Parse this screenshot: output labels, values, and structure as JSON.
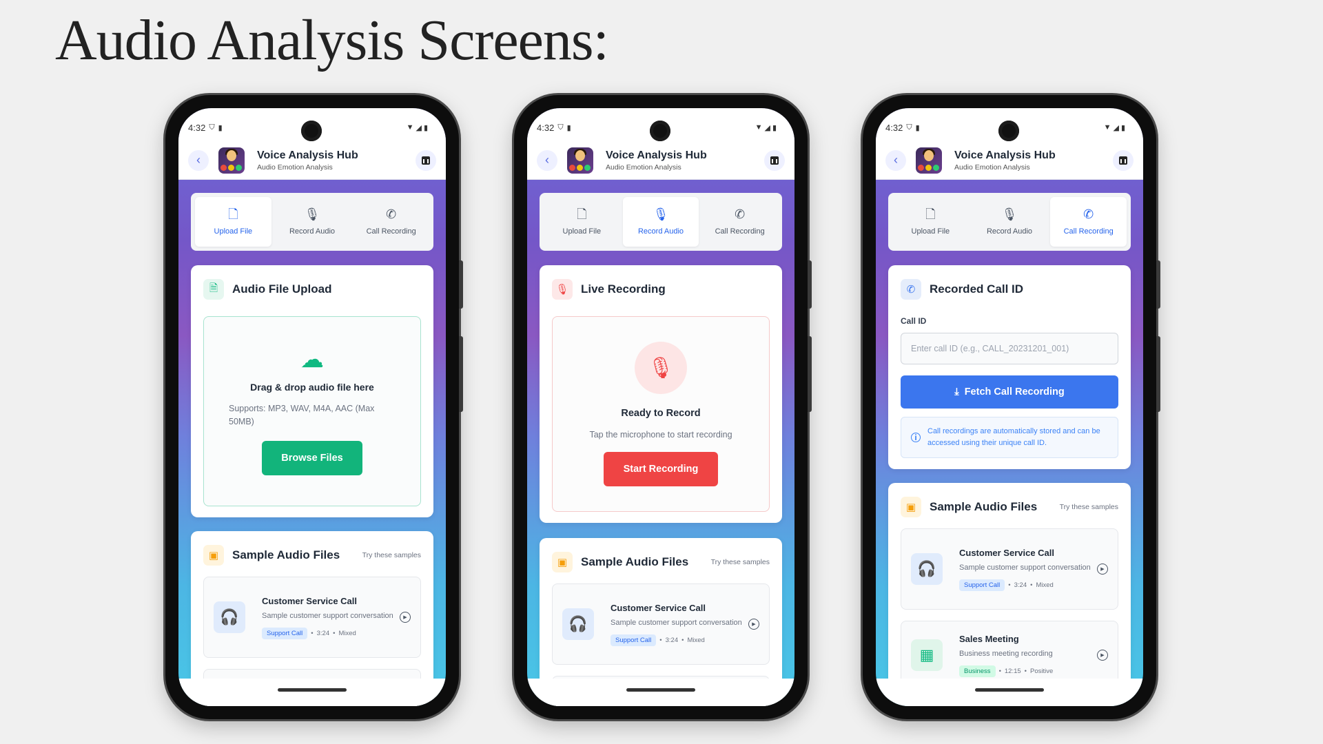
{
  "slide_title": "Audio Analysis Screens:",
  "status": {
    "time": "4:32"
  },
  "app": {
    "title": "Voice Analysis Hub",
    "subtitle": "Audio Emotion Analysis"
  },
  "tabs": [
    {
      "label": "Upload File",
      "icon": "file-upload-icon"
    },
    {
      "label": "Record Audio",
      "icon": "mic-icon"
    },
    {
      "label": "Call Recording",
      "icon": "phone-icon"
    }
  ],
  "upload_card": {
    "title": "Audio File Upload",
    "drop_title": "Drag & drop audio file here",
    "drop_sub": "Supports: MP3, WAV, M4A, AAC (Max 50MB)",
    "button": "Browse Files",
    "accent": "#12b47b"
  },
  "record_card": {
    "title": "Live Recording",
    "ready": "Ready to Record",
    "hint": "Tap the microphone to start recording",
    "button": "Start Recording",
    "accent": "#ef4444"
  },
  "call_card": {
    "title": "Recorded Call ID",
    "field_label": "Call ID",
    "placeholder": "Enter call ID (e.g., CALL_20231201_001)",
    "button": "Fetch Call Recording",
    "info": "Call recordings are automatically stored and can be accessed using their unique call ID.",
    "accent": "#3b76ee"
  },
  "samples": {
    "title": "Sample Audio Files",
    "hint": "Try these samples",
    "items": [
      {
        "title": "Customer Service Call",
        "desc": "Sample customer support conversation",
        "tag": "Support Call",
        "duration": "3:24",
        "sentiment": "Mixed",
        "icon": "headphones-icon"
      },
      {
        "title": "Sales Meeting",
        "desc": "Business meeting recording",
        "tag": "Business",
        "duration": "12:15",
        "sentiment": "Positive",
        "icon": "building-icon"
      }
    ]
  }
}
